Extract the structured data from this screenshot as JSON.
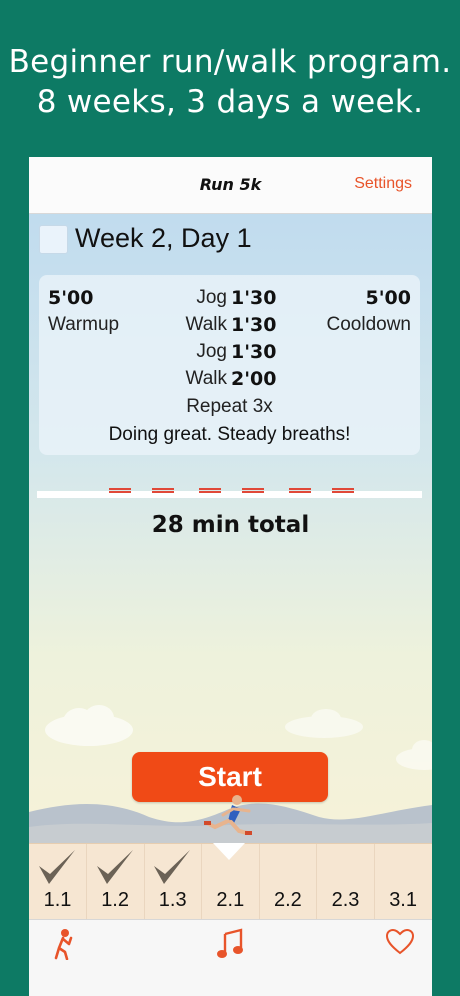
{
  "headline": {
    "line1": "Beginner run/walk program.",
    "line2": "8 weeks, 3 days a week."
  },
  "navbar": {
    "title": "Run 5k",
    "settings_label": "Settings"
  },
  "workout": {
    "day_title": "Week 2, Day 1",
    "completed": false,
    "warmup_time": "5'00",
    "warmup_label": "Warmup",
    "cooldown_time": "5'00",
    "cooldown_label": "Cooldown",
    "intervals": [
      {
        "label": "Jog",
        "time": "1'30"
      },
      {
        "label": "Walk",
        "time": "1'30"
      },
      {
        "label": "Jog",
        "time": "1'30"
      },
      {
        "label": "Walk",
        "time": "2'00"
      }
    ],
    "repeat": "Repeat 3x",
    "message": "Doing great. Steady breaths!",
    "total": "28 min total"
  },
  "start_label": "Start",
  "days": [
    {
      "label": "1.1",
      "done": true
    },
    {
      "label": "1.2",
      "done": true
    },
    {
      "label": "1.3",
      "done": true
    },
    {
      "label": "2.1",
      "done": false,
      "selected": true
    },
    {
      "label": "2.2",
      "done": false
    },
    {
      "label": "2.3",
      "done": false
    },
    {
      "label": "3.1",
      "done": false
    }
  ],
  "tabs": [
    {
      "icon": "stretching-figure-icon"
    },
    {
      "icon": "music-note-icon"
    },
    {
      "icon": "heart-icon"
    }
  ],
  "colors": {
    "background": "#0d7a64",
    "accent": "#f04a16",
    "settings": "#e8542a"
  }
}
